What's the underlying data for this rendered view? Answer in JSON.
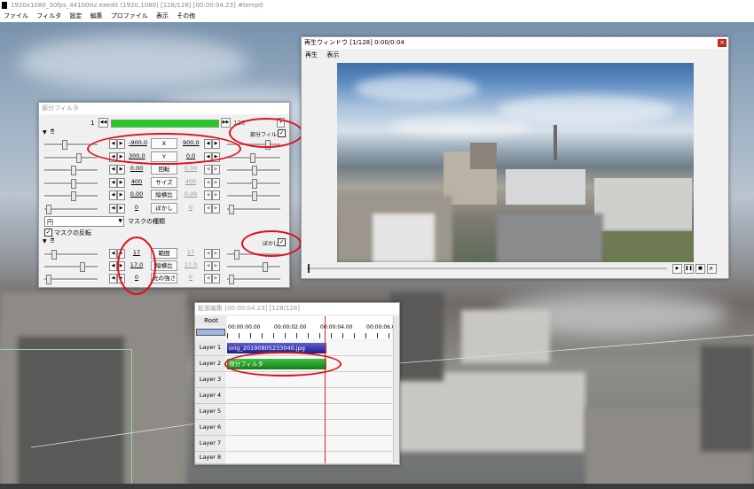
{
  "app": {
    "title": "1920x1080_30fps_44100Hz.exedit (1920,1080) [128/128] [00:00:04.23] #temp0",
    "menu": [
      "ファイル",
      "フィルタ",
      "設定",
      "編集",
      "プロファイル",
      "表示",
      "その他"
    ]
  },
  "filter_window": {
    "title": "部分フィルタ",
    "frame_value": "1",
    "frame_end": "128",
    "header_label": "部分フィルタ",
    "params": [
      {
        "left": "-900.0",
        "name": "X",
        "right": "900.0"
      },
      {
        "left": "300.0",
        "name": "Y",
        "right": "0.0"
      },
      {
        "left": "0.00",
        "name": "回転",
        "right": "0.00"
      },
      {
        "left": "400",
        "name": "サイズ",
        "right": "400"
      },
      {
        "left": "0.00",
        "name": "縦横比",
        "right": "0.00"
      },
      {
        "left": "0",
        "name": "ぼかし",
        "right": "0"
      }
    ],
    "mask_select": "円",
    "mask_label": "マスクの種類",
    "invert_label": "マスクの反転",
    "blur_header_label": "ぼかし",
    "blur_params": [
      {
        "left": "17",
        "name": "範囲",
        "right": "17"
      },
      {
        "left": "17.0",
        "name": "縦横比",
        "right": "17.0"
      },
      {
        "left": "0",
        "name": "光の強さ",
        "right": "0"
      }
    ]
  },
  "playback_window": {
    "title": "再生ウィンドウ [1/128]  0:00/0:04",
    "menu": [
      "再生",
      "表示"
    ]
  },
  "timeline_window": {
    "title": "拡張編集 [00:00:04.23] [128/128]",
    "root_label": "Root",
    "time_marks": [
      "00:00:00.00",
      "00:00:02.00",
      "00:00:04.00",
      "00:00:06.0"
    ],
    "layers": [
      "Layer 1",
      "Layer 2",
      "Layer 3",
      "Layer 4",
      "Layer 5",
      "Layer 6",
      "Layer 7",
      "Layer 8"
    ],
    "clip_image": "orig_20190805233040.jpg",
    "clip_filter": "部分フィルタ"
  }
}
